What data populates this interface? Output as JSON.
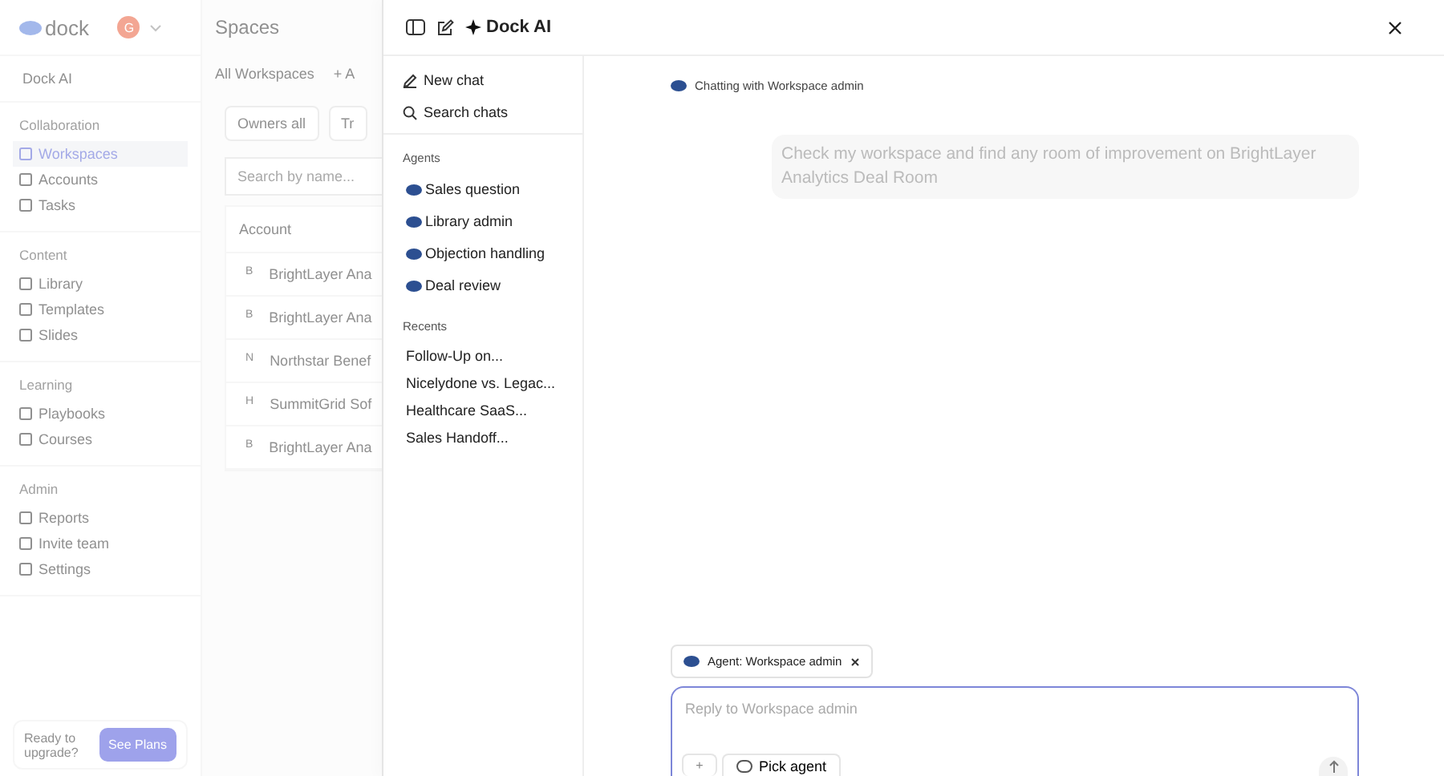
{
  "app": {
    "logo": "dock",
    "avatar": "G"
  },
  "sidebar": {
    "top_item": "Dock AI",
    "sections": [
      {
        "title": "Collaboration",
        "items": [
          {
            "label": "Workspaces",
            "selected": true
          },
          {
            "label": "Accounts",
            "selected": false
          },
          {
            "label": "Tasks",
            "selected": false
          }
        ]
      },
      {
        "title": "Content",
        "items": [
          {
            "label": "Library",
            "selected": false
          },
          {
            "label": "Templates",
            "selected": false
          },
          {
            "label": "Slides",
            "selected": false
          }
        ]
      },
      {
        "title": "Learning",
        "items": [
          {
            "label": "Playbooks",
            "selected": false
          },
          {
            "label": "Courses",
            "selected": false
          }
        ]
      },
      {
        "title": "Admin",
        "items": [
          {
            "label": "Reports",
            "selected": false
          },
          {
            "label": "Invite team",
            "selected": false
          },
          {
            "label": "Settings",
            "selected": false
          }
        ]
      }
    ],
    "upgrade": {
      "text": "Ready to upgrade?",
      "button": "See Plans"
    }
  },
  "background_page": {
    "title": "Spaces",
    "tabs": [
      "All Workspaces",
      "+ A"
    ],
    "filters": [
      "Owners all",
      "Tr"
    ],
    "search": {
      "placeholder": "Search by name..."
    },
    "column_1": "Account",
    "rows": [
      {
        "initial": "B",
        "name": "BrightLayer Ana"
      },
      {
        "initial": "B",
        "name": "BrightLayer Ana"
      },
      {
        "initial": "N",
        "name": "Northstar Benef"
      },
      {
        "initial": "H",
        "name": "SummitGrid Sof"
      },
      {
        "initial": "B",
        "name": "BrightLayer Ana"
      }
    ]
  },
  "panel": {
    "title": "Dock AI",
    "actions": [
      "New chat",
      "Search chats"
    ],
    "agents_heading": "Agents",
    "agents": [
      "Sales question",
      "Library admin",
      "Objection handling",
      "Deal review"
    ],
    "recents_heading": "Recents",
    "recents": [
      "Follow-Up on...",
      "Nicelydone vs. Legac...",
      "Healthcare SaaS...",
      "Sales Handoff..."
    ]
  },
  "chat": {
    "status": "Chatting with Workspace admin",
    "messages": [
      {
        "text": "Check my workspace and find any room of improvement on BrightLayer Analytics Deal Room"
      }
    ],
    "agent_chip": "Agent: Workspace admin",
    "composer": {
      "placeholder": "Reply to Workspace admin",
      "plus": "+",
      "pick_agent": "Pick agent"
    }
  }
}
